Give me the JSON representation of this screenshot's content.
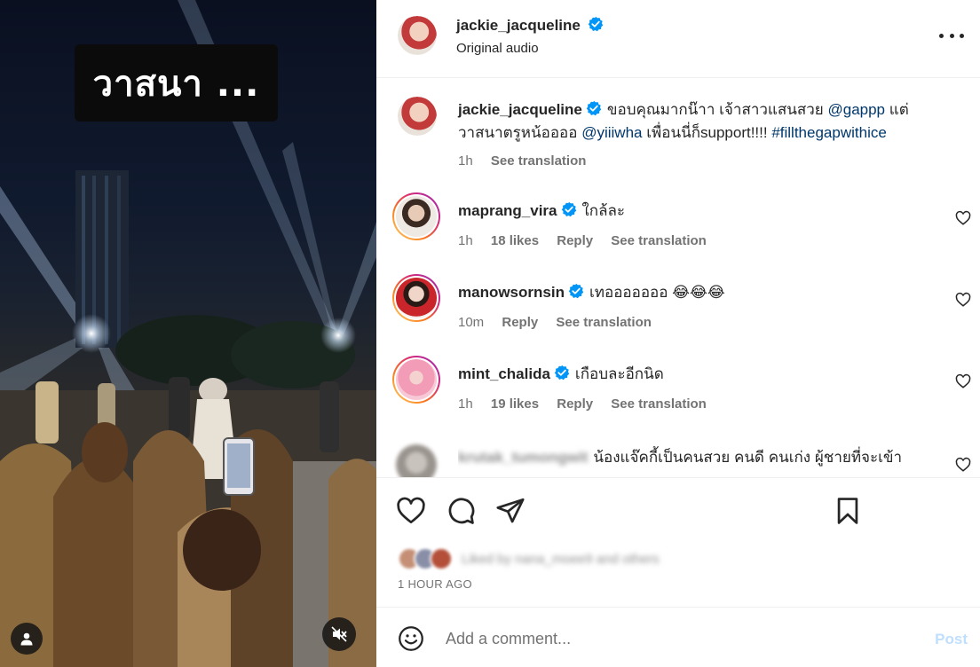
{
  "media": {
    "caption": "วาสนา ...",
    "user_tag_icon": "user-icon",
    "mute_icon": "muted-speaker-icon"
  },
  "header": {
    "username": "jackie_jacqueline",
    "audio": "Original audio",
    "more_icon": "more-horizontal-icon"
  },
  "post_caption": {
    "username": "jackie_jacqueline",
    "text_1": "ขอบคุณมากน๊าา เจ้าสาวแสนสวย",
    "mention_1": "@gappp",
    "text_2": "แต่ วาสนาตรูหน้ออออ",
    "mention_2": "@yiiiwha",
    "text_3": "เพื่อนนี่ก็support!!!!",
    "hashtag": "#fillthegapwithice",
    "time": "1h",
    "see_translation": "See translation"
  },
  "comments": [
    {
      "username": "maprang_vira",
      "text": "ใกล้ละ",
      "time": "1h",
      "likes": "18 likes",
      "reply": "Reply",
      "see_translation": "See translation"
    },
    {
      "username": "manowsornsin",
      "text": "เทอออออออ 😂😂😂",
      "time": "10m",
      "likes": "",
      "reply": "Reply",
      "see_translation": "See translation"
    },
    {
      "username": "mint_chalida",
      "text": "เกือบละอีกนิด",
      "time": "1h",
      "likes": "19 likes",
      "reply": "Reply",
      "see_translation": "See translation"
    },
    {
      "username": "krutak_tumongwit",
      "text": "น้องแจ๊คกี้เป็นคนสวย คนดี คนเก่ง ผู้ชายที่จะเข้า"
    }
  ],
  "actions": {
    "like_icon": "heart-icon",
    "comment_icon": "comment-icon",
    "share_icon": "send-icon",
    "save_icon": "bookmark-icon",
    "liked_by": "Liked by nana_moee9 and others",
    "time_ago": "1 HOUR AGO"
  },
  "add_comment": {
    "emoji_icon": "smiley-icon",
    "placeholder": "Add a comment...",
    "post_label": "Post"
  },
  "colors": {
    "verified": "#0095f6",
    "link": "#00376b",
    "post_disabled": "#c0dffd"
  }
}
